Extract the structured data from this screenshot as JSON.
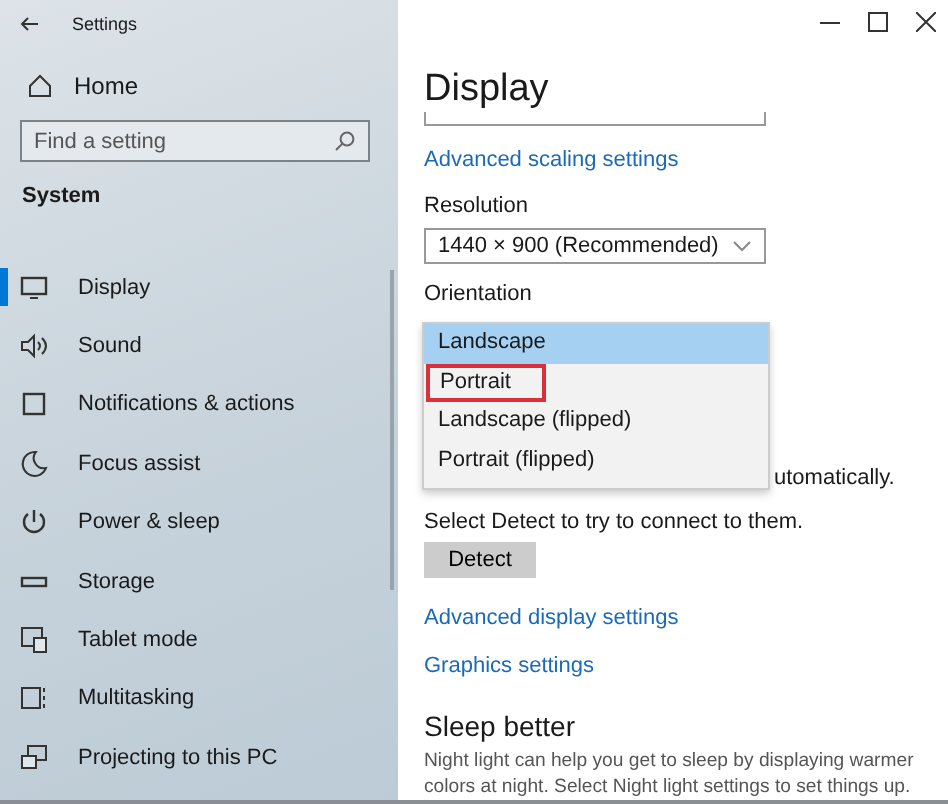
{
  "window": {
    "title": "Settings"
  },
  "sidebar": {
    "home": "Home",
    "search": {
      "placeholder": "Find a setting"
    },
    "section": "System",
    "items": [
      {
        "label": "Display",
        "selected": true
      },
      {
        "label": "Sound",
        "selected": false
      },
      {
        "label": "Notifications & actions",
        "selected": false
      },
      {
        "label": "Focus assist",
        "selected": false
      },
      {
        "label": "Power & sleep",
        "selected": false
      },
      {
        "label": "Storage",
        "selected": false
      },
      {
        "label": "Tablet mode",
        "selected": false
      },
      {
        "label": "Multitasking",
        "selected": false
      },
      {
        "label": "Projecting to this PC",
        "selected": false
      }
    ]
  },
  "content": {
    "title": "Display",
    "scaling_link": "Advanced scaling settings",
    "resolution_label": "Resolution",
    "resolution_value": "1440 × 900 (Recommended)",
    "orientation_label": "Orientation",
    "orientation_options": [
      {
        "label": "Landscape",
        "selected": true,
        "highlighted": false
      },
      {
        "label": "Portrait",
        "selected": false,
        "highlighted": true
      },
      {
        "label": "Landscape (flipped)",
        "selected": false,
        "highlighted": false
      },
      {
        "label": "Portrait (flipped)",
        "selected": false,
        "highlighted": false
      }
    ],
    "hidden_line_tail": "utomatically.",
    "detect_hint": "Select Detect to try to connect to them.",
    "detect_button": "Detect",
    "links": [
      "Advanced display settings",
      "Graphics settings"
    ],
    "sleep_heading": "Sleep better",
    "sleep_text": "Night light can help you get to sleep by displaying warmer colors at night. Select Night light settings to set things up."
  }
}
